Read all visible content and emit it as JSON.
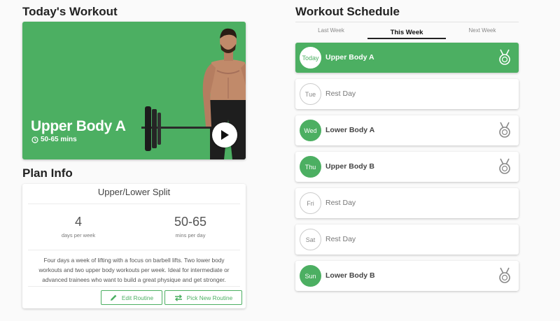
{
  "todays_workout": {
    "heading": "Today's Workout",
    "name": "Upper Body A",
    "duration": "50-65 mins",
    "icons": {
      "clock": "clock-icon",
      "play": "play-icon"
    }
  },
  "plan_info": {
    "heading": "Plan Info",
    "name": "Upper/Lower Split",
    "days_value": "4",
    "days_label": "days per week",
    "mins_value": "50-65",
    "mins_label": "mins per day",
    "description": "Four days a week of lifting with a focus on barbell lifts. Two lower body workouts and two upper body workouts per week. Ideal for intermediate or advanced trainees who want to build a great physique and get stronger.",
    "edit_label": "Edit Routine",
    "pick_label": "Pick New Routine",
    "icons": {
      "edit": "pencil-icon",
      "pick": "swap-icon"
    }
  },
  "schedule": {
    "heading": "Workout Schedule",
    "tabs": [
      "Last Week",
      "This Week",
      "Next Week"
    ],
    "active_tab": "This Week",
    "days": [
      {
        "day": "Today",
        "workout": "Upper Body A",
        "type": "workout",
        "today": true,
        "medal": true
      },
      {
        "day": "Tue",
        "workout": "Rest Day",
        "type": "rest",
        "today": false,
        "medal": false
      },
      {
        "day": "Wed",
        "workout": "Lower Body A",
        "type": "workout",
        "today": false,
        "medal": true
      },
      {
        "day": "Thu",
        "workout": "Upper Body B",
        "type": "workout",
        "today": false,
        "medal": true
      },
      {
        "day": "Fri",
        "workout": "Rest Day",
        "type": "rest",
        "today": false,
        "medal": false
      },
      {
        "day": "Sat",
        "workout": "Rest Day",
        "type": "rest",
        "today": false,
        "medal": false
      },
      {
        "day": "Sun",
        "workout": "Lower Body B",
        "type": "workout",
        "today": false,
        "medal": true
      }
    ]
  },
  "colors": {
    "accent": "#4caf62",
    "card": "#ffffff",
    "background": "#fafafa"
  }
}
